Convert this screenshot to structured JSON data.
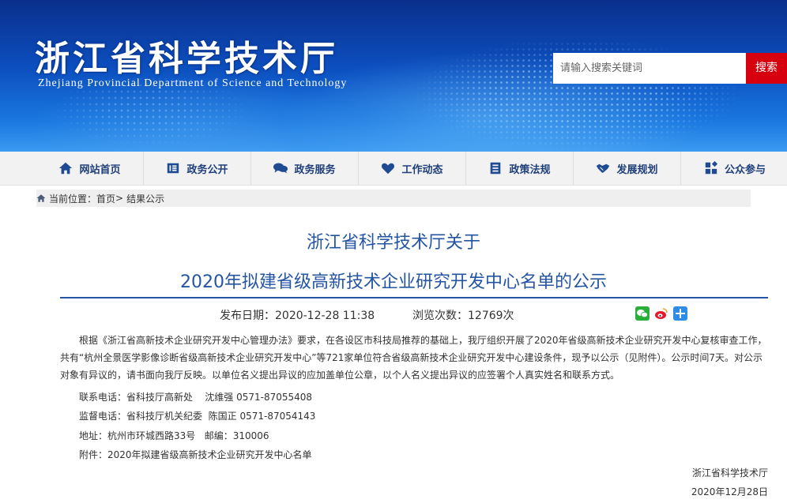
{
  "header": {
    "site_title": "浙江省科学技术厅",
    "site_subtitle": "Zhejiang Provincial Department of Science and Technology",
    "search_placeholder": "请输入搜索关键词",
    "search_button": "搜索"
  },
  "nav": {
    "items": [
      {
        "label": "网站首页",
        "icon": "home-icon"
      },
      {
        "label": "政务公开",
        "icon": "document-icon"
      },
      {
        "label": "政务服务",
        "icon": "chat-icon"
      },
      {
        "label": "工作动态",
        "icon": "heart-icon"
      },
      {
        "label": "政策法规",
        "icon": "list-icon"
      },
      {
        "label": "发展规划",
        "icon": "handshake-icon"
      },
      {
        "label": "公众参与",
        "icon": "participate-icon"
      }
    ]
  },
  "breadcrumb": {
    "prefix": "当前位置：",
    "home": "首页",
    "separator": ">",
    "current": "结果公示"
  },
  "article": {
    "title_line1": "浙江省科学技术厅关于",
    "title_line2": "2020年拟建省级高新技术企业研究开发中心名单的公示",
    "publish_date_label": "发布日期：",
    "publish_date": "2020-12-28 11:38",
    "views_label": "浏览次数：",
    "views": "12769次",
    "share_icons": [
      "wechat-icon",
      "weibo-icon",
      "more-share-icon"
    ],
    "paragraph": "根据《浙江省高新技术企业研究开发中心管理办法》要求，在各设区市科技局推荐的基础上，我厅组织开展了2020年省级高新技术企业研究开发中心复核审查工作，共有“杭州全景医学影像诊断省级高新技术企业研究开发中心”等721家单位符合省级高新技术企业研究开发中心建设条件，现予以公示（见附件）。公示时间7天。对公示对象有异议的，请书面向我厅反映。以单位名义提出异议的应加盖单位公章，以个人名义提出异议的应签署个人真实姓名和联系方式。",
    "contact": "联系电话：省科技厅高新处    沈维强 0571-87055408",
    "supervision": "监督电话：省科技厅机关纪委  陈国正 0571-87054143",
    "address": "地址：杭州市环城西路33号   邮编：310006",
    "attachment": "附件：2020年拟建省级高新技术企业研究开发中心名单",
    "signature": "浙江省科学技术厅",
    "sign_date": "2020年12月28日"
  },
  "colors": {
    "banner_blue": "#0c4fbf",
    "title_blue": "#2455a3",
    "search_red": "#d7000f",
    "nav_bg": "#f2f2f2"
  }
}
